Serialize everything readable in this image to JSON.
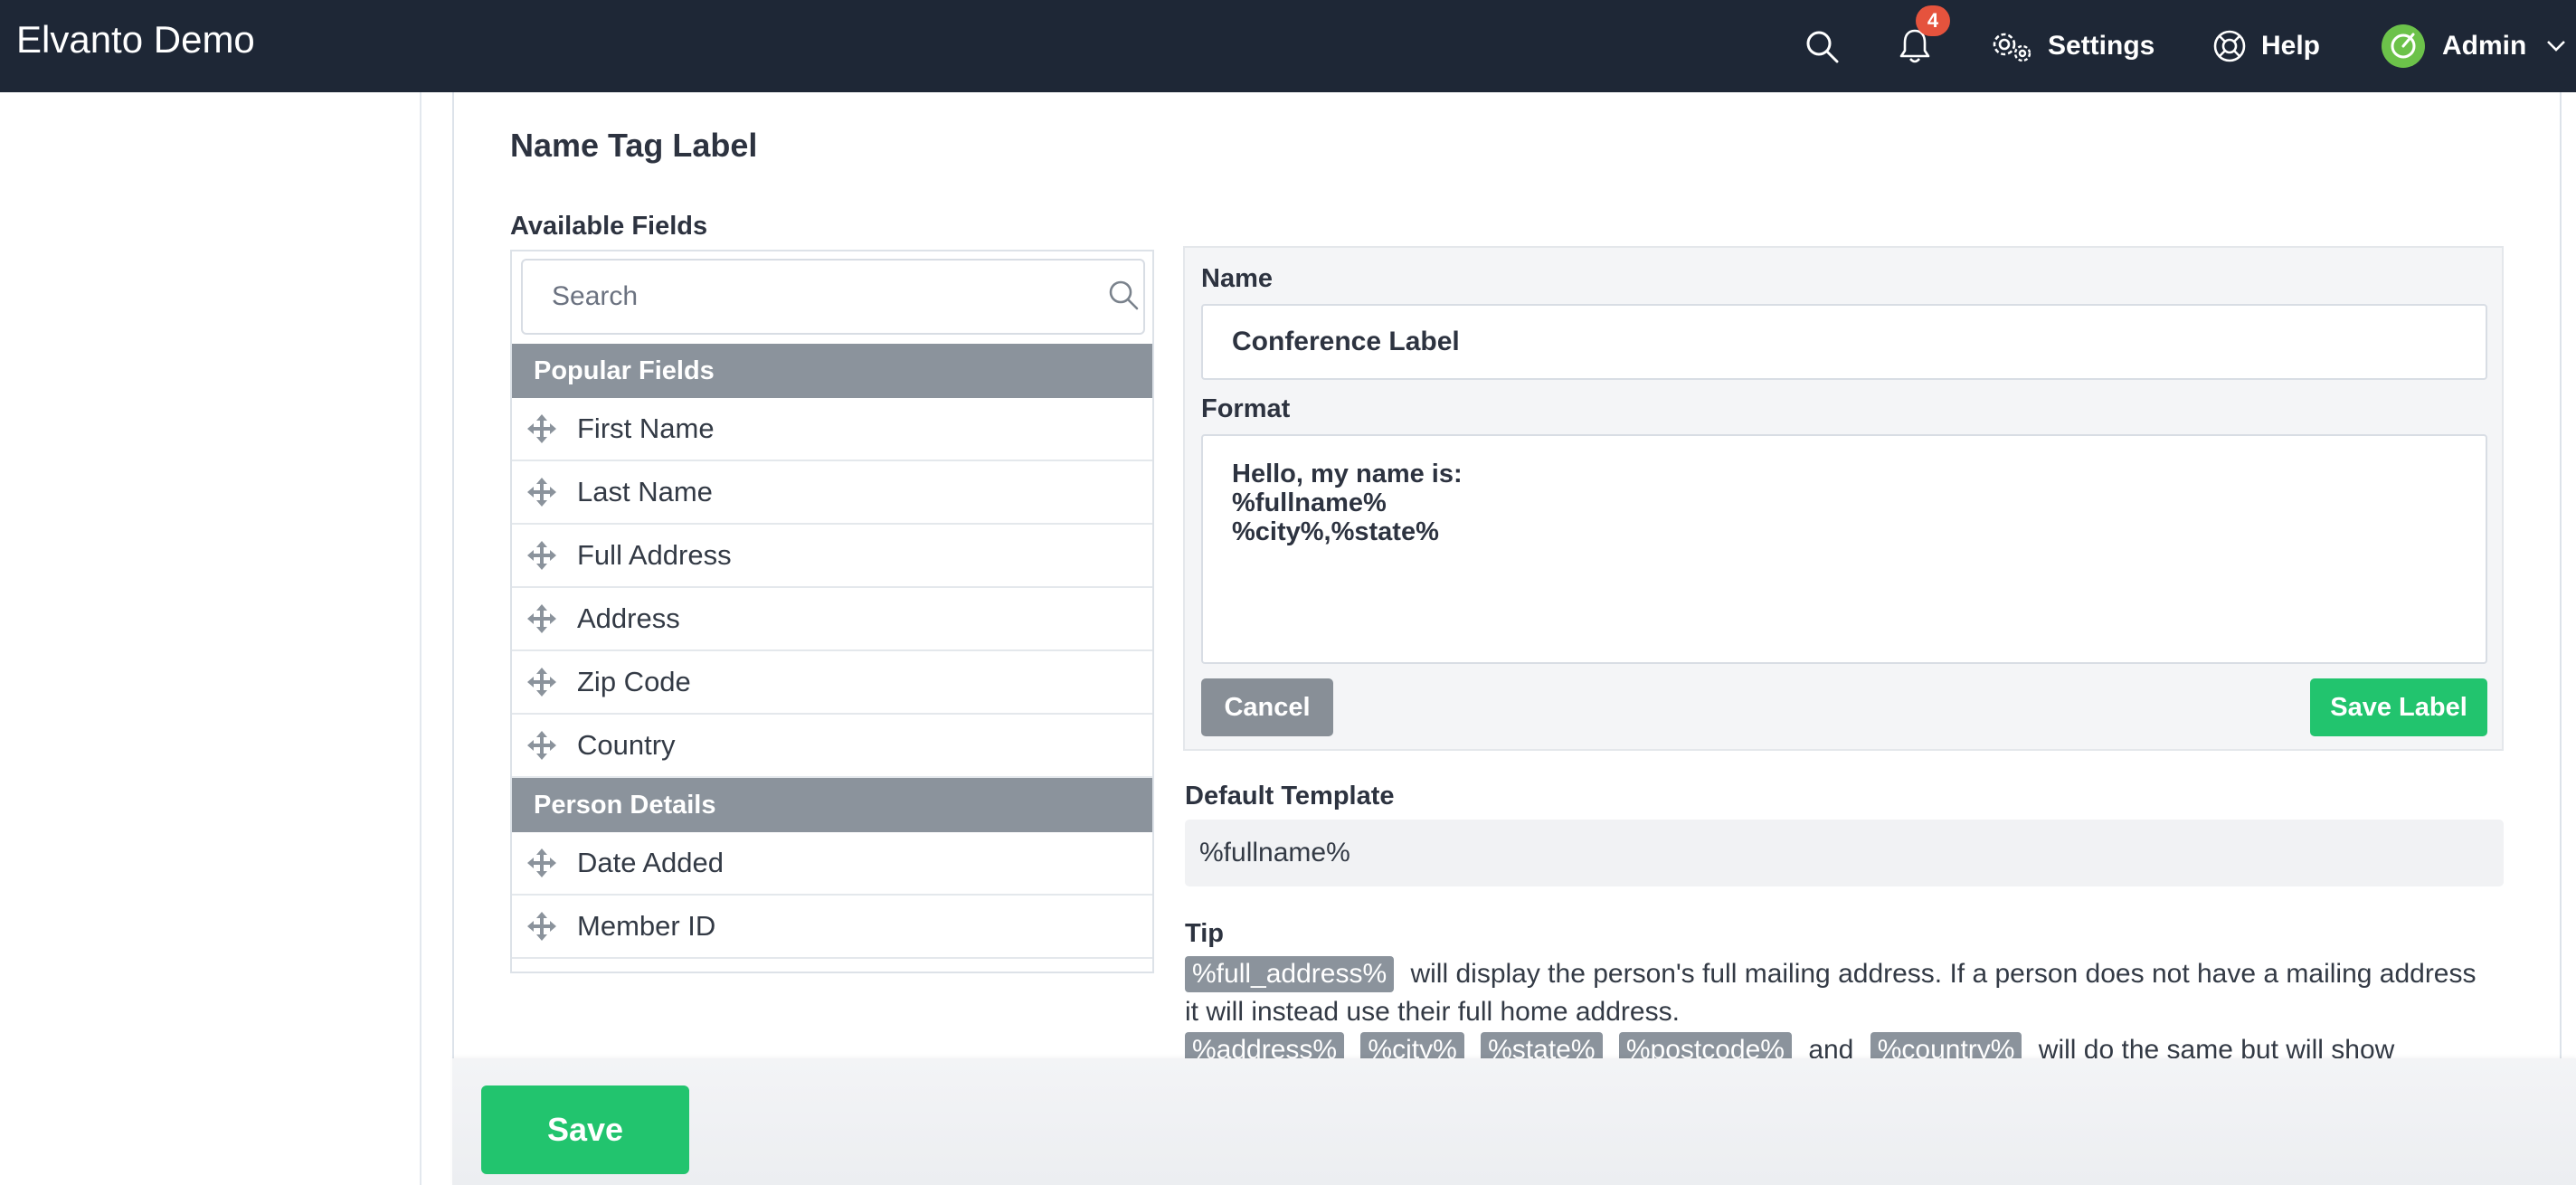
{
  "header": {
    "brand": "Elvanto Demo",
    "notification_count": "4",
    "settings_label": "Settings",
    "help_label": "Help",
    "user_label": "Admin"
  },
  "page": {
    "title": "Name Tag Label",
    "available_fields_label": "Available Fields"
  },
  "fields": {
    "search_placeholder": "Search",
    "groups": [
      {
        "name": "Popular Fields",
        "items": [
          "First Name",
          "Last Name",
          "Full Address",
          "Address",
          "Zip Code",
          "Country"
        ]
      },
      {
        "name": "Person Details",
        "items": [
          "Date Added",
          "Member ID"
        ]
      }
    ]
  },
  "form": {
    "name_label": "Name",
    "name_value": "Conference Label",
    "format_label": "Format",
    "format_value": "Hello, my name is:\n%fullname%\n%city%,%state%",
    "cancel_label": "Cancel",
    "save_label_label": "Save Label"
  },
  "default_template": {
    "label": "Default Template",
    "value": "%fullname%"
  },
  "tip": {
    "label": "Tip",
    "tag_full_address": "%full_address%",
    "text1": "will display the person's full mailing address. If a person does not have a mailing address it will instead use their full home address.",
    "tag_address": "%address%",
    "tag_city": "%city%",
    "tag_state": "%state%",
    "tag_postcode": "%postcode%",
    "and_text": "and",
    "tag_country": "%country%",
    "text2": "will do the same but will show"
  },
  "footer": {
    "save_label": "Save"
  },
  "colors": {
    "topbar": "#1e2736",
    "accent_green": "#22c46e",
    "group_header": "#8b939c",
    "badge": "#e5533d"
  }
}
